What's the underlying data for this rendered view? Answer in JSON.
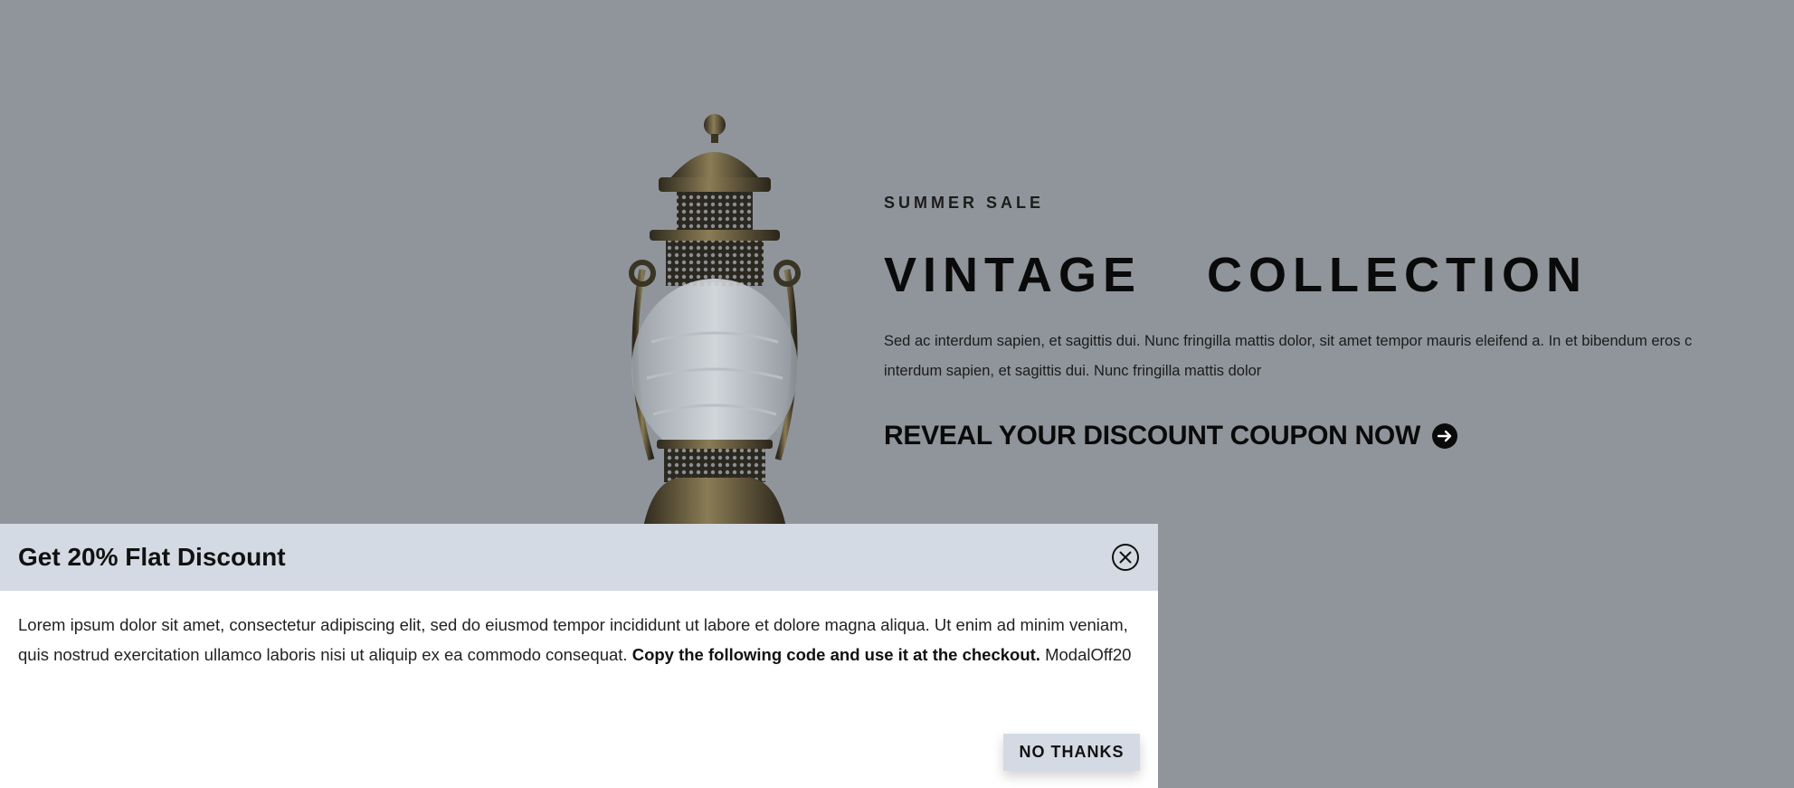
{
  "hero": {
    "eyebrow": "SUMMER SALE",
    "title": "VINTAGE  COLLECTION",
    "description": "Sed ac interdum sapien, et sagittis dui. Nunc fringilla mattis dolor, sit amet tempor mauris eleifend a. In et bibendum eros c interdum sapien, et sagittis dui. Nunc fringilla mattis dolor",
    "cta_label": "REVEAL YOUR DISCOUNT COUPON NOW",
    "cta_icon": "arrow-right-circle-icon",
    "image": "vintage-lantern",
    "background_color": "#9da1a7"
  },
  "modal": {
    "title": "Get 20% Flat Discount",
    "body_text": "Lorem ipsum dolor sit amet, consectetur adipiscing elit, sed do eiusmod tempor incididunt ut labore et dolore magna aliqua. Ut enim ad minim veniam, quis nostrud exercitation ullamco laboris nisi ut aliquip ex ea commodo consequat.",
    "body_emphasis": "Copy the following code and use it at the checkout.",
    "coupon_code": "ModalOff20",
    "close_icon": "close-circle-icon",
    "dismiss_label": "NO THANKS",
    "header_color": "#d4dae3"
  }
}
